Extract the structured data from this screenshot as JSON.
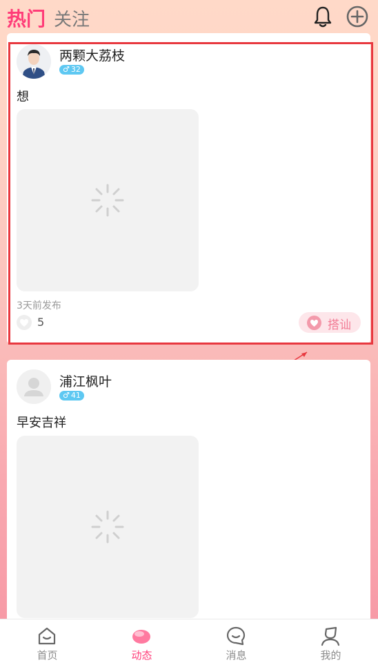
{
  "header": {
    "tab_hot": "热门",
    "tab_follow": "关注",
    "icons": [
      "bell-icon",
      "plus-circle-icon"
    ]
  },
  "posts": [
    {
      "username": "两颗大荔枝",
      "gender_symbol": "♂",
      "age": "32",
      "text": "想",
      "time": "3天前发布",
      "likes": "5",
      "chat_label": "搭讪"
    },
    {
      "username": "浦江枫叶",
      "gender_symbol": "♂",
      "age": "41",
      "text": "早安吉祥"
    }
  ],
  "bottom_nav": [
    {
      "label": "首页",
      "icon": "home-icon"
    },
    {
      "label": "动态",
      "icon": "moments-icon",
      "active": true
    },
    {
      "label": "消息",
      "icon": "message-icon"
    },
    {
      "label": "我的",
      "icon": "profile-icon"
    }
  ],
  "colors": {
    "accent": "#ff3c78",
    "badge": "#5ec8f2",
    "highlight": "#e8383f",
    "chat_button_bg": "#fde6ea"
  }
}
